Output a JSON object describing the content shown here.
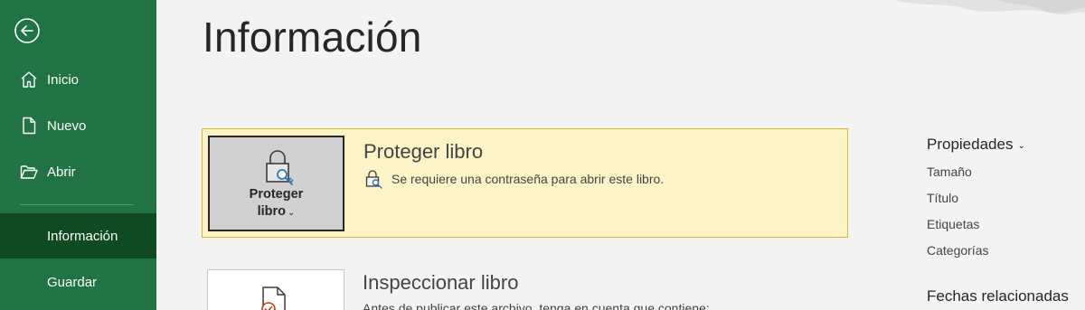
{
  "sidebar": {
    "back_label": "",
    "items": [
      {
        "label": "Inicio",
        "icon": "home-icon"
      },
      {
        "label": "Nuevo",
        "icon": "new-document-icon"
      },
      {
        "label": "Abrir",
        "icon": "open-folder-icon"
      },
      {
        "label": "Información",
        "selected": true
      },
      {
        "label": "Guardar"
      }
    ]
  },
  "main": {
    "title": "Información",
    "protect": {
      "button_label_line1": "Proteger",
      "button_label_line2": "libro",
      "heading": "Proteger libro",
      "description": "Se requiere una contraseña para abrir este libro."
    },
    "inspect": {
      "heading": "Inspeccionar libro",
      "description": "Antes de publicar este archivo, tenga en cuenta que contiene:"
    }
  },
  "properties": {
    "heading": "Propiedades",
    "items": [
      "Tamaño",
      "Título",
      "Etiquetas",
      "Categorías"
    ],
    "related_heading": "Fechas relacionadas"
  },
  "colors": {
    "sidebar": "#217346",
    "sidebar_selected": "#0f4a24",
    "card_background": "#fcf4c6",
    "card_border": "#d7b23e",
    "accent_icon": "#2e75b6"
  }
}
